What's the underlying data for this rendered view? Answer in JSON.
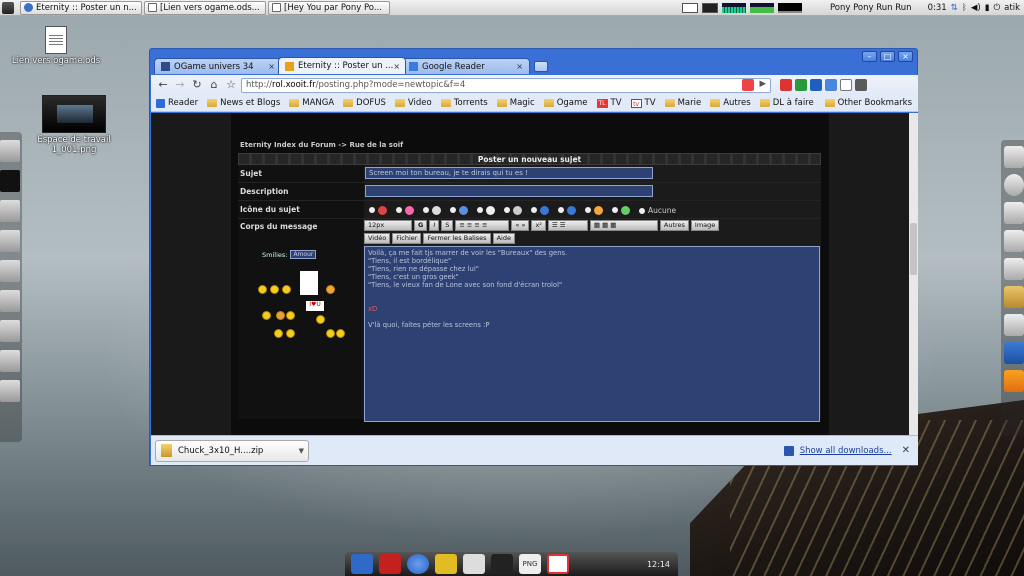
{
  "taskbar": {
    "tasks": [
      "Eternity :: Poster un n...",
      "[Lien vers ogame.ods...",
      "[Hey You par Pony Po..."
    ],
    "now_playing": "Pony Pony Run Run",
    "time": "0:31",
    "user": "atik"
  },
  "desktop": {
    "icons": [
      {
        "label": "Lien vers ogame.ods"
      },
      {
        "label": "Espace de travail 1_001.png"
      }
    ]
  },
  "browser": {
    "tabs": [
      {
        "label": "OGame univers 34",
        "active": false
      },
      {
        "label": "Eternity :: Poster un ...",
        "active": true
      },
      {
        "label": "Google Reader",
        "active": false
      }
    ],
    "url_scheme": "http://",
    "url_host": "rol.xooit.fr",
    "url_path": "/posting.php?mode=newtopic&f=4",
    "bookmarks": [
      "Reader",
      "News et Blogs",
      "MANGA",
      "DOFUS",
      "Video",
      "Torrents",
      "Magic",
      "Ogame",
      "TV",
      "TV",
      "Marie",
      "Autres",
      "DL à faire"
    ],
    "other_bookmarks": "Other Bookmarks",
    "download_file": "Chuck_3x10_H....zip",
    "show_all_downloads": "Show all downloads..."
  },
  "forum": {
    "breadcrumb": "Eternity Index du Forum -> Rue de la soif",
    "section_title": "Poster un nouveau sujet",
    "subject_label": "Sujet",
    "subject_value": "Screen moi ton bureau, je te dirais qui tu es !",
    "description_label": "Description",
    "icon_label": "Icône du sujet",
    "icon_none": "Aucune",
    "body_label": "Corps du message",
    "smilies_label": "Smilies:",
    "smilies_select": "Amour",
    "format_buttons": [
      "12px",
      "G",
      "I",
      "S",
      "Autres",
      "Image"
    ],
    "format_buttons2": [
      "Vidéo",
      "Fichier",
      "Fermer les Balises",
      "Aide"
    ],
    "message_lines": [
      "Voilà, ça me fait tjs marrer de voir les \"Bureaux\" des gens.",
      "\"Tiens, il est bordélique\"",
      "\"Tiens, rien ne dépasse chez lui\"",
      "\"Tiens, c'est un gros geek\"",
      "\"Tiens, le vieux fan de Lone avec son fond d'écran trolol\""
    ],
    "message_xd": "xD",
    "message_end": "V'là quoi, faites péter les screens :P"
  },
  "dock": {
    "clock": "12:14",
    "png_label": "PNG"
  }
}
